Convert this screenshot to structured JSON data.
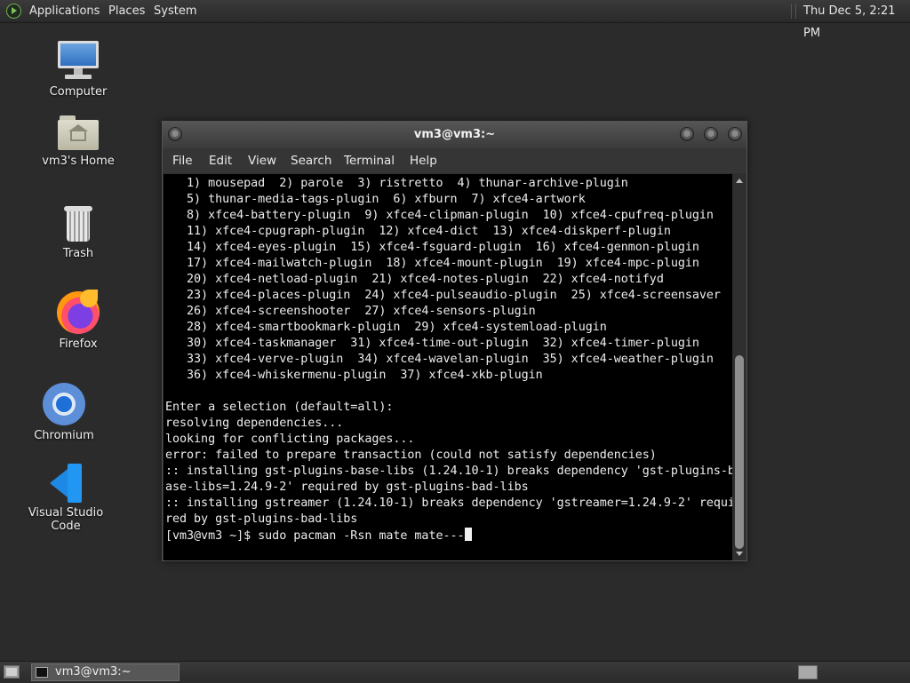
{
  "top_panel": {
    "menus": [
      "Applications",
      "Places",
      "System"
    ],
    "clock": "Thu Dec  5,  2:21 PM"
  },
  "desktop_icons": [
    {
      "label": "Computer",
      "icon": "computer-icon"
    },
    {
      "label": "vm3's Home",
      "icon": "home-folder-icon"
    },
    {
      "label": "Trash",
      "icon": "trash-icon"
    },
    {
      "label": "Firefox",
      "icon": "firefox-icon"
    },
    {
      "label": "Chromium",
      "icon": "chromium-icon"
    },
    {
      "label": "Visual Studio Code",
      "icon": "vscode-icon"
    }
  ],
  "terminal": {
    "title": "vm3@vm3:~",
    "menu": [
      "File",
      "Edit",
      "View",
      "Search",
      "Terminal",
      "Help"
    ],
    "lines": [
      "   1) mousepad  2) parole  3) ristretto  4) thunar-archive-plugin",
      "   5) thunar-media-tags-plugin  6) xfburn  7) xfce4-artwork",
      "   8) xfce4-battery-plugin  9) xfce4-clipman-plugin  10) xfce4-cpufreq-plugin",
      "   11) xfce4-cpugraph-plugin  12) xfce4-dict  13) xfce4-diskperf-plugin",
      "   14) xfce4-eyes-plugin  15) xfce4-fsguard-plugin  16) xfce4-genmon-plugin",
      "   17) xfce4-mailwatch-plugin  18) xfce4-mount-plugin  19) xfce4-mpc-plugin",
      "   20) xfce4-netload-plugin  21) xfce4-notes-plugin  22) xfce4-notifyd",
      "   23) xfce4-places-plugin  24) xfce4-pulseaudio-plugin  25) xfce4-screensaver",
      "   26) xfce4-screenshooter  27) xfce4-sensors-plugin",
      "   28) xfce4-smartbookmark-plugin  29) xfce4-systemload-plugin",
      "   30) xfce4-taskmanager  31) xfce4-time-out-plugin  32) xfce4-timer-plugin",
      "   33) xfce4-verve-plugin  34) xfce4-wavelan-plugin  35) xfce4-weather-plugin",
      "   36) xfce4-whiskermenu-plugin  37) xfce4-xkb-plugin",
      "",
      "Enter a selection (default=all):",
      "resolving dependencies...",
      "looking for conflicting packages...",
      "error: failed to prepare transaction (could not satisfy dependencies)",
      ":: installing gst-plugins-base-libs (1.24.10-1) breaks dependency 'gst-plugins-b",
      "ase-libs=1.24.9-2' required by gst-plugins-bad-libs",
      ":: installing gstreamer (1.24.10-1) breaks dependency 'gstreamer=1.24.9-2' requi",
      "red by gst-plugins-bad-libs"
    ],
    "prompt": "[vm3@vm3 ~]$ sudo pacman -Rsn mate mate---"
  },
  "taskbar": {
    "task_label": "vm3@vm3:~"
  }
}
